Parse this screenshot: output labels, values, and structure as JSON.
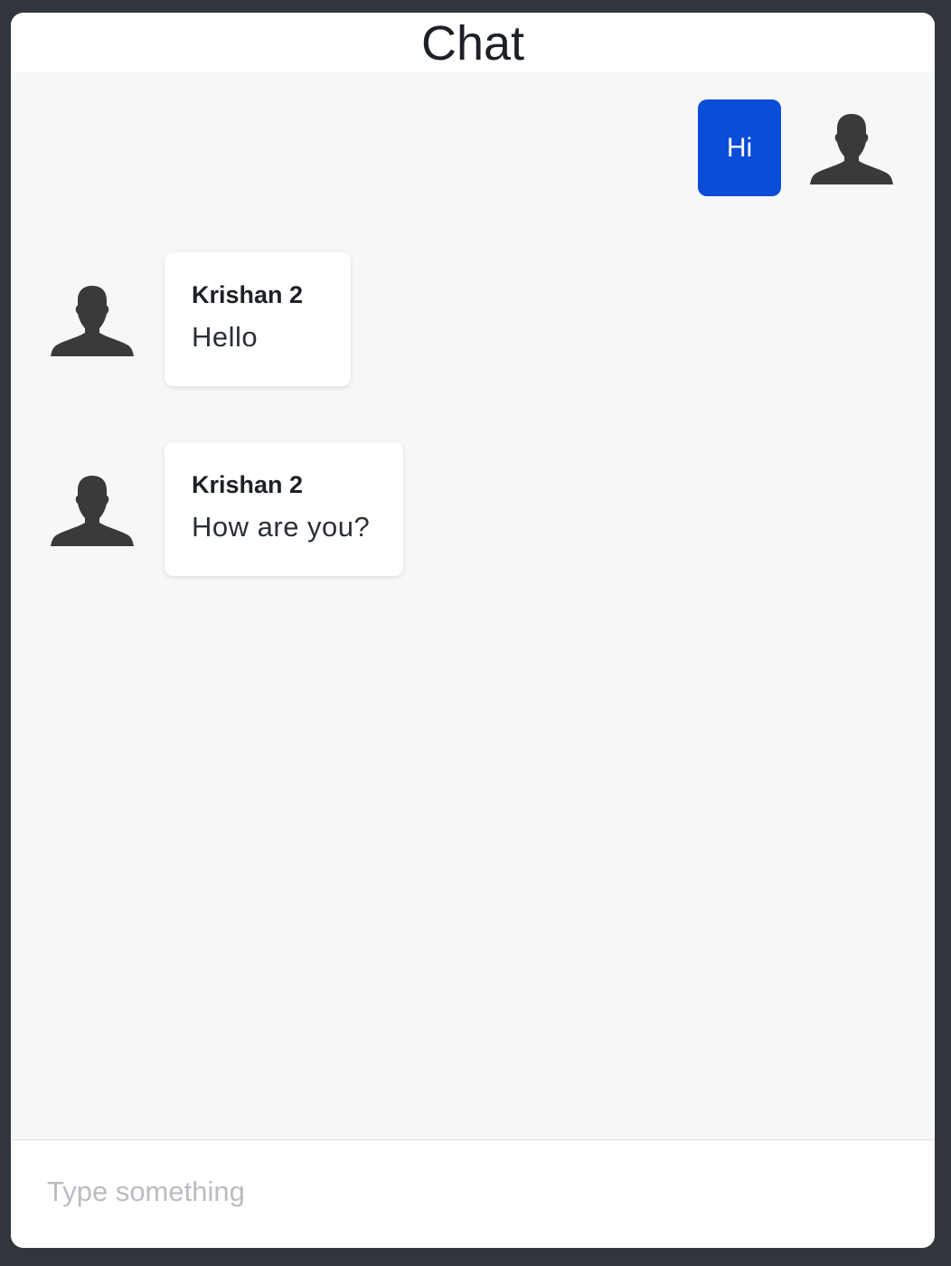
{
  "header": {
    "title": "Chat"
  },
  "messages": [
    {
      "direction": "outgoing",
      "text": "Hi",
      "avatar_icon": "user-silhouette-icon"
    },
    {
      "direction": "incoming",
      "sender": "Krishan 2",
      "text": "Hello",
      "avatar_icon": "user-silhouette-icon"
    },
    {
      "direction": "incoming",
      "sender": "Krishan 2",
      "text": "How are you?",
      "avatar_icon": "user-silhouette-icon"
    }
  ],
  "composer": {
    "placeholder": "Type something",
    "value": ""
  },
  "colors": {
    "page_background": "#30363b",
    "chat_background": "#f6f7f9",
    "outgoing_bubble": "#0b4cd9",
    "incoming_bubble": "#ffffff",
    "avatar": "#3a3a3a"
  }
}
